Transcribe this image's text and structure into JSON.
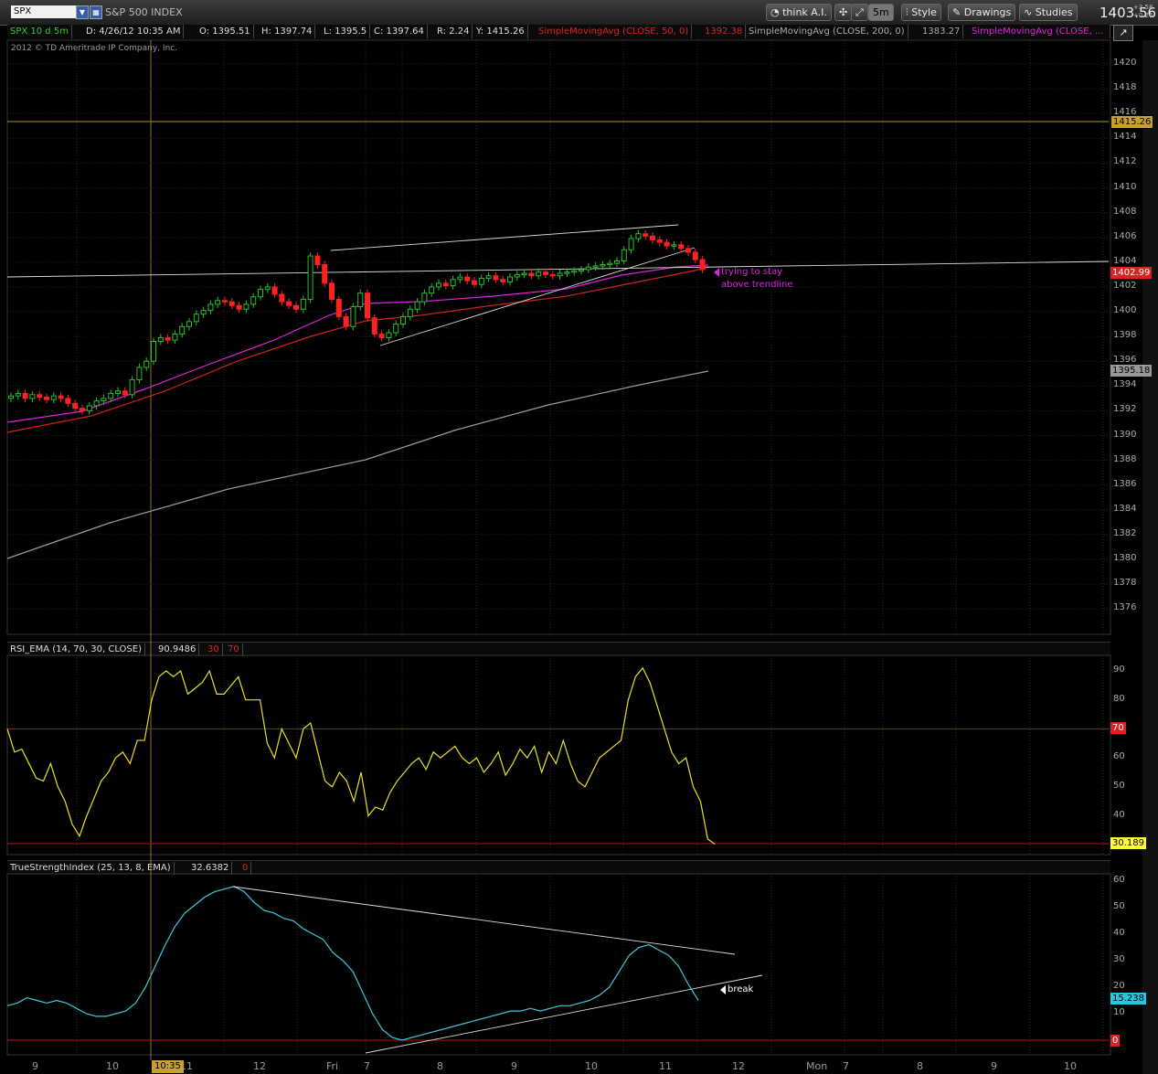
{
  "toolbar": {
    "symbol": "SPX",
    "symbol_name": "S&P 500 INDEX",
    "thinkai": "think A.I.",
    "interval": "5m",
    "style": "Style",
    "drawings": "Drawings",
    "studies": "Studies",
    "last_price": "1403.56",
    "change_up": "+3.58",
    "change_pct": "+0.26"
  },
  "infobar": {
    "symbol": "SPX 10 d 5m",
    "date": "D: 4/26/12 10:35 AM",
    "open": "O: 1395.51",
    "high": "H: 1397.74",
    "low": "L: 1395.5",
    "close": "C: 1397.64",
    "range": "R: 2.24",
    "yclose": "Y: 1415.26",
    "sma50_label": "SimpleMovingAvg (CLOSE, 50, 0)",
    "sma50_value": "1392.38",
    "sma200_label": "SimpleMovingAvg (CLOSE, 200, 0)",
    "sma200_value": "1383.27",
    "sma_other_label": "SimpleMovingAvg (CLOSE, ..."
  },
  "copyright": "2012 © TD Ameritrade IP Company, Inc.",
  "price_axis": [
    "1420",
    "1418",
    "1416",
    "1414",
    "1412",
    "1410",
    "1408",
    "1406",
    "1404",
    "1402",
    "1400",
    "1398",
    "1396",
    "1394",
    "1392",
    "1390",
    "1388",
    "1386",
    "1384",
    "1382",
    "1380",
    "1378",
    "1376"
  ],
  "price_tags": {
    "yclose": "1415.26",
    "last": "1402.99",
    "sma200": "1395.18"
  },
  "annotation": {
    "line1": "trying to stay",
    "line2": "above trendline",
    "break": "break"
  },
  "rsi": {
    "label": "RSI_EMA (14, 70, 30, CLOSE)",
    "value": "90.9486",
    "low": "30",
    "high": "70",
    "axis": [
      "90",
      "80",
      "70",
      "60",
      "50",
      "40"
    ],
    "tag70": "70",
    "tag_last": "30.189"
  },
  "tsi": {
    "label": "TrueStrengthIndex (25, 13, 8, EMA)",
    "value": "32.6382",
    "zero": "0",
    "axis": [
      "60",
      "50",
      "40",
      "30",
      "20",
      "10"
    ],
    "tag_last": "15.238",
    "tag_zero": "0"
  },
  "xaxis": {
    "labels": [
      "9",
      "10",
      "11",
      "12",
      "Fri",
      "7",
      "8",
      "9",
      "10",
      "11",
      "12",
      "Mon",
      "7",
      "8",
      "9",
      "10"
    ],
    "time_tag": "10:35"
  },
  "colors": {
    "up": "#26c026",
    "down": "#ff2020",
    "sma_red": "#d02020",
    "sma_magenta": "#e020e0",
    "sma_gray": "#9a9a9a",
    "rsi_line": "#e8e020",
    "tsi_line": "#40c8e0",
    "level_red": "#c01010"
  }
}
